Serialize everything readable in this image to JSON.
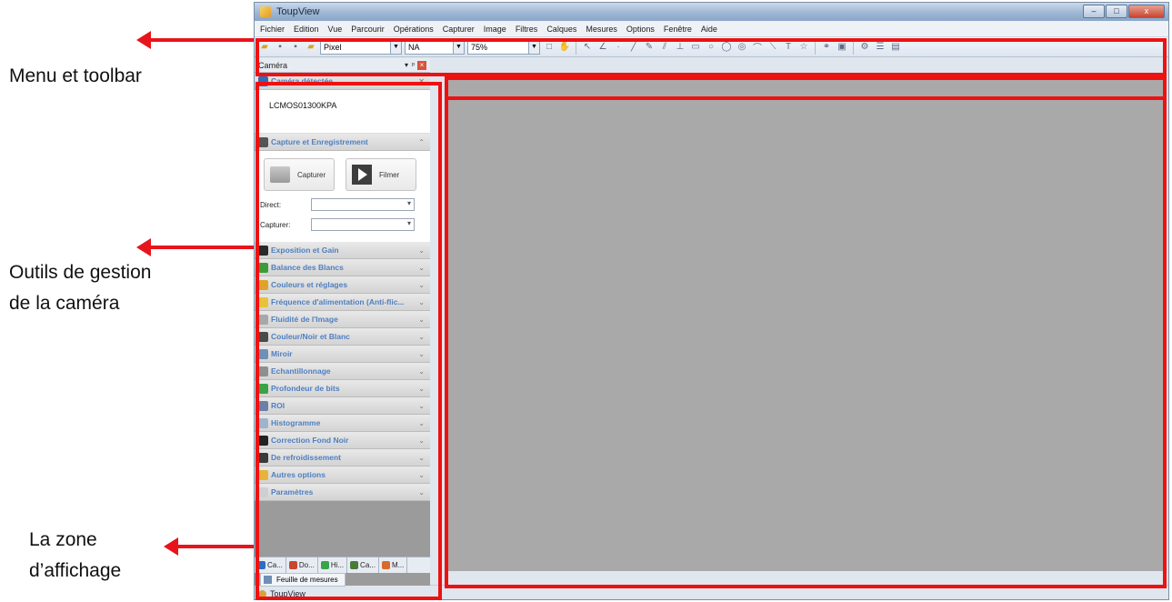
{
  "annotations": {
    "menu_toolbar": "Menu et toolbar",
    "camera_tools_line1": "Outils de gestion",
    "camera_tools_line2": "de la caméra",
    "display_zone_line1": "La zone",
    "display_zone_line2": "d’affichage"
  },
  "window": {
    "title": "ToupView",
    "controls": {
      "minimize": "–",
      "maximize": "□",
      "close": "x"
    }
  },
  "menubar": {
    "items": [
      "Fichier",
      "Edition",
      "Vue",
      "Parcourir",
      "Opérations",
      "Capturer",
      "Image",
      "Filtres",
      "Calques",
      "Mesures",
      "Options",
      "Fenêtre",
      "Aide"
    ]
  },
  "toolbar": {
    "unit_select": "Pixel",
    "calibration_select": "NA",
    "zoom_select": "75%"
  },
  "panel": {
    "title": "Caméra",
    "camera_section": {
      "label": "Caméra détectée",
      "device": "LCMOS01300KPA"
    },
    "capture_section": {
      "label": "Capture et Enregistrement",
      "capture_button": "Capturer",
      "record_button": "Filmer",
      "direct_label": "Direct:",
      "capture_label": "Capturer:"
    },
    "sections": [
      {
        "label": "Exposition et Gain",
        "icon_color": "#2a2a2a"
      },
      {
        "label": "Balance des Blancs",
        "icon_color": "#3f9b3a"
      },
      {
        "label": "Couleurs et réglages",
        "icon_color": "#e0a22a"
      },
      {
        "label": "Fréquence d'alimentation (Anti-flic...",
        "icon_color": "#e8c23a"
      },
      {
        "label": "Fluidité de l'Image",
        "icon_color": "#a8a8a8"
      },
      {
        "label": "Couleur/Noir et Blanc",
        "icon_color": "#4a4a4a"
      },
      {
        "label": "Miroir",
        "icon_color": "#6d8fb8"
      },
      {
        "label": "Echantillonnage",
        "icon_color": "#8f8f8f"
      },
      {
        "label": "Profondeur de bits",
        "icon_color": "#3aa34a"
      },
      {
        "label": "ROI",
        "icon_color": "#6c7fa6"
      },
      {
        "label": "Histogramme",
        "icon_color": "#9fb3cc"
      },
      {
        "label": "Correction Fond Noir",
        "icon_color": "#222222"
      },
      {
        "label": "De refroidissement",
        "icon_color": "#3b3b3b"
      },
      {
        "label": "Autres options",
        "icon_color": "#e8b33a"
      },
      {
        "label": "Paramètres",
        "icon_color": "#cfcfcf"
      }
    ],
    "tabs": [
      {
        "label": "Ca...",
        "icon_color": "#2a6fc0"
      },
      {
        "label": "Do...",
        "icon_color": "#c8472e"
      },
      {
        "label": "Hi...",
        "icon_color": "#3aa34a"
      },
      {
        "label": "Ca...",
        "icon_color": "#4a7a3a"
      },
      {
        "label": "M...",
        "icon_color": "#d86a2e"
      }
    ],
    "sheet_tab": "Feuille de mesures",
    "bottom_title": "ToupView"
  },
  "colors": {
    "highlight": "#ee1111",
    "display_zone": "#a9a9a9",
    "section_label": "#4f7fc0"
  }
}
